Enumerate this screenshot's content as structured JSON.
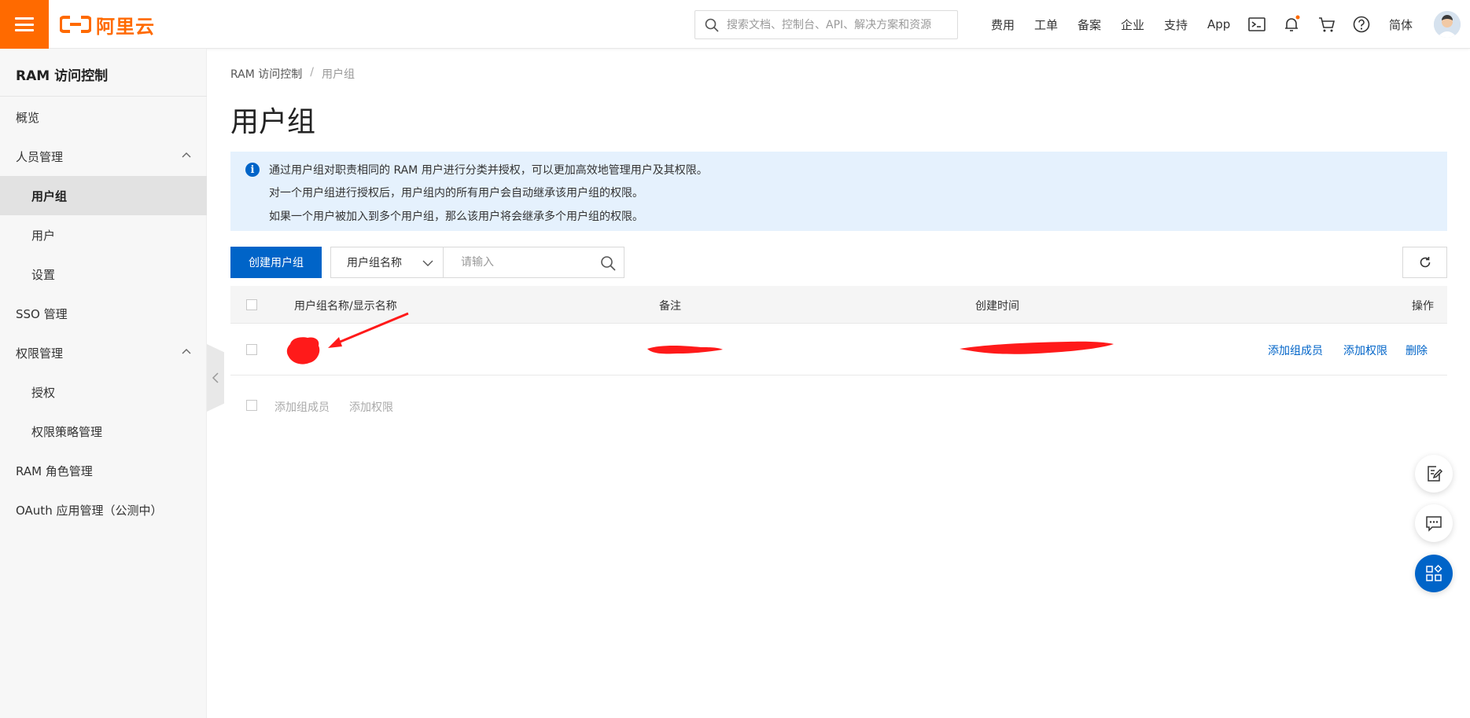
{
  "brand": {
    "logo_text": "阿里云",
    "accent": "#ff6a00",
    "primary": "#0064c8"
  },
  "header": {
    "search_placeholder": "搜索文档、控制台、API、解决方案和资源",
    "nav": [
      "费用",
      "工单",
      "备案",
      "企业",
      "支持",
      "App"
    ],
    "lang": "简体",
    "icons": [
      "terminal-icon",
      "bell-icon",
      "cart-icon",
      "help-icon"
    ]
  },
  "sidebar": {
    "title": "RAM 访问控制",
    "items": [
      {
        "label": "概览",
        "level": 1
      },
      {
        "label": "人员管理",
        "level": 1,
        "expanded": true
      },
      {
        "label": "用户组",
        "level": 2,
        "active": true
      },
      {
        "label": "用户",
        "level": 2
      },
      {
        "label": "设置",
        "level": 2
      },
      {
        "label": "SSO 管理",
        "level": 1
      },
      {
        "label": "权限管理",
        "level": 1,
        "expanded": true
      },
      {
        "label": "授权",
        "level": 2
      },
      {
        "label": "权限策略管理",
        "level": 2
      },
      {
        "label": "RAM 角色管理",
        "level": 1
      },
      {
        "label": "OAuth 应用管理（公测中）",
        "level": 1
      }
    ]
  },
  "breadcrumb": {
    "root": "RAM 访问控制",
    "sep": "/",
    "current": "用户组"
  },
  "page": {
    "title": "用户组"
  },
  "notice": {
    "lines": [
      "通过用户组对职责相同的 RAM 用户进行分类并授权，可以更加高效地管理用户及其权限。",
      "对一个用户组进行授权后，用户组内的所有用户会自动继承该用户组的权限。",
      "如果一个用户被加入到多个用户组，那么该用户将会继承多个用户组的权限。"
    ]
  },
  "toolbar": {
    "create_label": "创建用户组",
    "filter_select": "用户组名称",
    "filter_placeholder": "请输入"
  },
  "table": {
    "columns": [
      "用户组名称/显示名称",
      "备注",
      "创建时间",
      "操作"
    ],
    "row_actions": [
      "添加组成员",
      "添加权限",
      "删除"
    ]
  },
  "bulk_actions": [
    "添加组成员",
    "添加权限"
  ]
}
